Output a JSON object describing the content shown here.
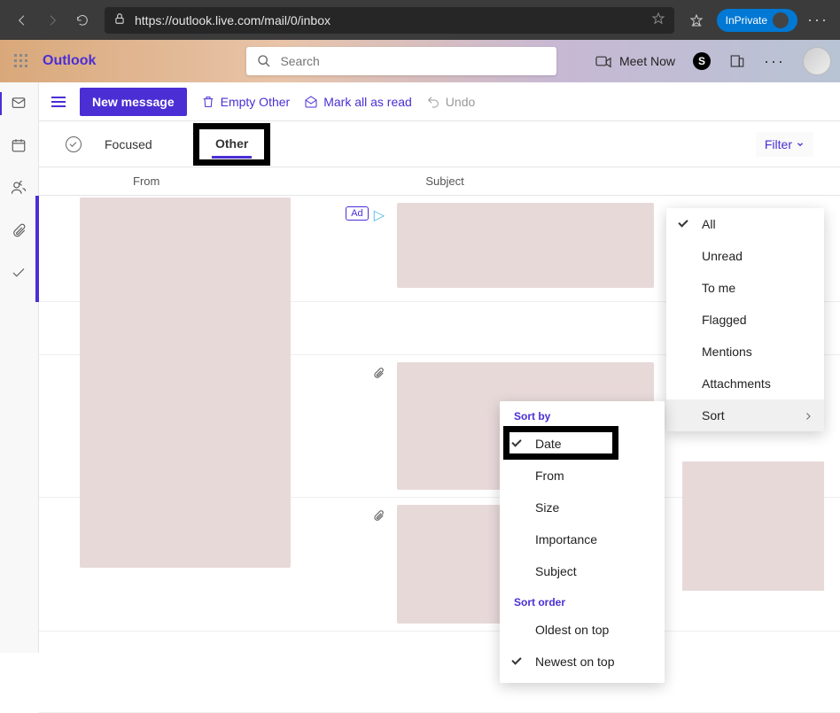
{
  "browser": {
    "url": "https://outlook.live.com/mail/0/inbox",
    "inprivate_label": "InPrivate"
  },
  "header": {
    "brand": "Outlook",
    "search_placeholder": "Search",
    "meet_now": "Meet Now"
  },
  "commands": {
    "new_message": "New message",
    "empty_other": "Empty Other",
    "mark_all_read": "Mark all as read",
    "undo": "Undo"
  },
  "tabs": {
    "focused": "Focused",
    "other": "Other",
    "filter": "Filter"
  },
  "columns": {
    "from": "From",
    "subject": "Subject"
  },
  "ad": {
    "label": "Ad"
  },
  "filter_menu": {
    "all": "All",
    "unread": "Unread",
    "to_me": "To me",
    "flagged": "Flagged",
    "mentions": "Mentions",
    "attachments": "Attachments",
    "sort": "Sort"
  },
  "sort_menu": {
    "sort_by": "Sort by",
    "date": "Date",
    "from": "From",
    "size": "Size",
    "importance": "Importance",
    "subject": "Subject",
    "sort_order": "Sort order",
    "oldest": "Oldest on top",
    "newest": "Newest on top"
  }
}
